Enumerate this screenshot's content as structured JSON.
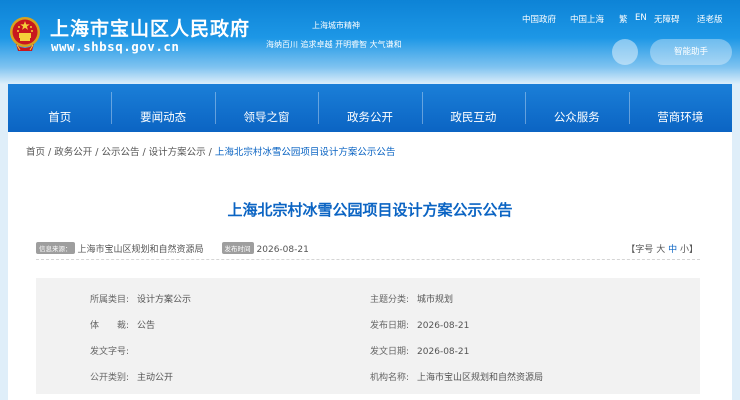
{
  "header": {
    "site_title": "上海市宝山区人民政府",
    "site_url": "www.shbsq.gov.cn",
    "spirit_title": "上海城市精神",
    "spirit_text": "海纳百川 追求卓越 开明睿智 大气谦和",
    "top_links": [
      "中国政府",
      "中国上海",
      "繁",
      "EN",
      "无障碍",
      "适老版"
    ],
    "assistant_label": "智能助手"
  },
  "nav": {
    "items": [
      "首页",
      "要闻动态",
      "领导之窗",
      "政务公开",
      "政民互动",
      "公众服务",
      "营商环境"
    ]
  },
  "breadcrumb": {
    "items": [
      "首页",
      "政务公开",
      "公示公告",
      "设计方案公示",
      "上海北宗村冰雪公园项目设计方案公示公告"
    ],
    "separator": "/"
  },
  "article": {
    "title": "上海北宗村冰雪公园项目设计方案公示公告",
    "source_tag": "信息来源：",
    "source": "上海市宝山区规划和自然资源局",
    "date_tag": "发布时间",
    "date": "2026-08-21",
    "font_size": {
      "prefix": "【字号",
      "large": "大",
      "medium": "中",
      "small": "小",
      "suffix": "】"
    }
  },
  "info": {
    "category_label": "所属类目:",
    "category": "设计方案公示",
    "topic_label": "主题分类:",
    "topic": "城市规划",
    "genre_label": "体　　裁:",
    "genre": "公告",
    "publish_date_label": "发布日期:",
    "publish_date": "2026-08-21",
    "doc_no_label": "发文字号:",
    "doc_no": "",
    "issue_date_label": "发文日期:",
    "issue_date": "2026-08-21",
    "public_type_label": "公开类别:",
    "public_type": "主动公开",
    "org_label": "机构名称:",
    "org": "上海市宝山区规划和自然资源局"
  },
  "colors": {
    "brand_blue": "#0b64c3",
    "header_blue": "#0d83d6",
    "tag_gray": "#9e9e9e"
  }
}
